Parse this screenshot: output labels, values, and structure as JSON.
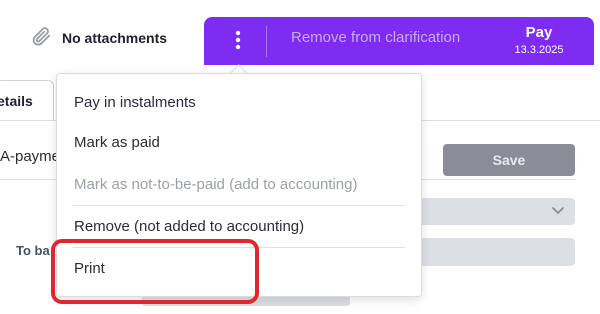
{
  "attachments": {
    "label": "No attachments",
    "icon": "paperclip-icon"
  },
  "action_bar": {
    "background": "#7e2cf2",
    "menu_icon": "more-vertical-icon",
    "remove_label": "Remove from clarification",
    "pay_label": "Pay",
    "pay_date": "13.3.2025"
  },
  "tabs": [
    {
      "label": "etails"
    }
  ],
  "form": {
    "field_label": "A-payme",
    "save_label": "Save",
    "to_bank_label": "To ba"
  },
  "menu": {
    "items": [
      {
        "label": "Pay in instalments",
        "disabled": false
      },
      {
        "label": "Mark as paid",
        "disabled": false
      },
      {
        "label": "Mark as not-to-be-paid (add to accounting)",
        "disabled": true
      },
      {
        "label": "Remove (not added to accounting)",
        "disabled": false
      },
      {
        "label": "Print",
        "disabled": false
      }
    ]
  },
  "highlight_color": "#e0282c"
}
